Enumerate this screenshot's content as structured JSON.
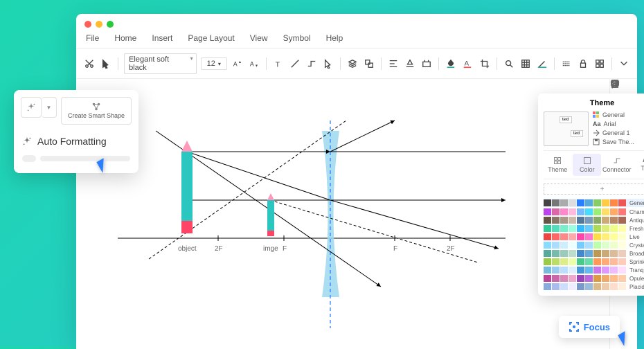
{
  "menubar": [
    "File",
    "Home",
    "Insert",
    "Page Layout",
    "View",
    "Symbol",
    "Help"
  ],
  "toolbar": {
    "font": "Elegant soft black",
    "size": "12"
  },
  "popup": {
    "create": "Create Smart Shape",
    "auto": "Auto Formatting"
  },
  "canvas": {
    "l_object": "object",
    "l_2f_left": "2F",
    "l_image": "imge",
    "l_f_left": "F",
    "l_f_right": "F",
    "l_2f_right": "2F"
  },
  "theme": {
    "title": "Theme",
    "opts": [
      "General",
      "Arial",
      "General 1",
      "Save The..."
    ],
    "tabs": [
      "Theme",
      "Color",
      "Connector",
      "Text"
    ],
    "swatches": [
      "General",
      "Charm",
      "Antique",
      "Fresh",
      "Live",
      "Crystal",
      "Broad",
      "Sprinkle",
      "Tranquil",
      "Opulent",
      "Placid"
    ]
  },
  "focus": "Focus",
  "swatch_palettes": [
    [
      "#444",
      "#777",
      "#aaa",
      "#ddd",
      "#2b7fff",
      "#5ad",
      "#8c6",
      "#fc4",
      "#f84",
      "#e55"
    ],
    [
      "#b4e",
      "#d6a",
      "#f8c",
      "#fbd",
      "#7bf",
      "#4df",
      "#9e7",
      "#fd6",
      "#fa6",
      "#f77"
    ],
    [
      "#654",
      "#876",
      "#a98",
      "#cba",
      "#579",
      "#79b",
      "#8a6",
      "#ca7",
      "#b86",
      "#a65"
    ],
    [
      "#3c9",
      "#5db",
      "#7ec",
      "#9fd",
      "#3bf",
      "#6cf",
      "#ad5",
      "#de7",
      "#ef8",
      "#ffa"
    ],
    [
      "#e44",
      "#f66",
      "#f88",
      "#faa",
      "#f4a",
      "#f7c",
      "#fd4",
      "#fe7",
      "#ff9",
      "#ffc"
    ],
    [
      "#8df",
      "#adf",
      "#cef",
      "#eff",
      "#7cf",
      "#adf",
      "#bfa",
      "#dfc",
      "#efc",
      "#ffd"
    ],
    [
      "#5a9",
      "#7ba",
      "#9cb",
      "#bdc",
      "#48c",
      "#6ad",
      "#b95",
      "#ca7",
      "#db9",
      "#ecb"
    ],
    [
      "#9c4",
      "#bd6",
      "#de8",
      "#efa",
      "#4c8",
      "#6da",
      "#f95",
      "#fa7",
      "#fb9",
      "#fcb"
    ],
    [
      "#7bd",
      "#9ce",
      "#bdf",
      "#def",
      "#49d",
      "#6be",
      "#c7e",
      "#d9f",
      "#ebf",
      "#fdf"
    ],
    [
      "#b49",
      "#c6a",
      "#d8b",
      "#eac",
      "#94b",
      "#b6d",
      "#d94",
      "#ea6",
      "#fb8",
      "#fca"
    ],
    [
      "#8ad",
      "#abe",
      "#cdf",
      "#eef",
      "#79c",
      "#9bd",
      "#db8",
      "#eca",
      "#fdc",
      "#fed"
    ]
  ]
}
